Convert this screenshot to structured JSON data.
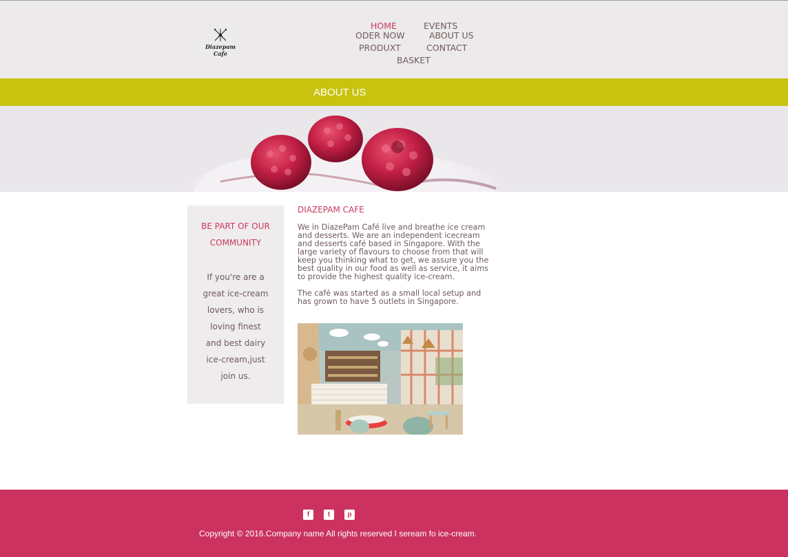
{
  "brand": {
    "logo_text": "Diazepam Cafe"
  },
  "nav": {
    "home": "HOME",
    "events": "EVENTS",
    "order_now": "ODER NOW",
    "about_us": "ABOUT US",
    "products": "PRODUXT",
    "contact": "CONTACT",
    "basket": "BASKET"
  },
  "page_bar": {
    "title": "ABOUT US"
  },
  "sidebar": {
    "heading_line1": "BE PART OF OUR",
    "heading_line2": "COMMUNITY",
    "text_lines": [
      "If you're are a",
      "great ice-cream",
      "lovers, who is",
      "loving finest",
      "and best dairy",
      "ice-cream,just",
      "join us."
    ]
  },
  "content": {
    "title": "DIAZEPAM CAFE",
    "paragraph1": "We in DiazePam Café live and breathe ice cream and desserts. We are an independent icecream and desserts café based in Singapore. With the large variety of flavours to choose from that will keep you thinking what to get, we assure you the best quality in our food as well as service, it aims to provide the highest quality ice-cream.",
    "paragraph2": "The café was started as a small local setup and has grown to have 5 outlets in Singapore."
  },
  "footer": {
    "social": {
      "facebook": "f",
      "twitter": "t",
      "pinterest": "p"
    },
    "copyright": "Copyright © 2016.Company name All rights reserved I seream fo ice-cream."
  },
  "colors": {
    "accent": "#c83a5e",
    "bar": "#c8c30f",
    "footer": "#cb325f",
    "header_bg": "#edeaeb"
  },
  "icons": [
    "crossed-arrows-icon",
    "facebook-icon",
    "twitter-icon",
    "pinterest-icon"
  ]
}
